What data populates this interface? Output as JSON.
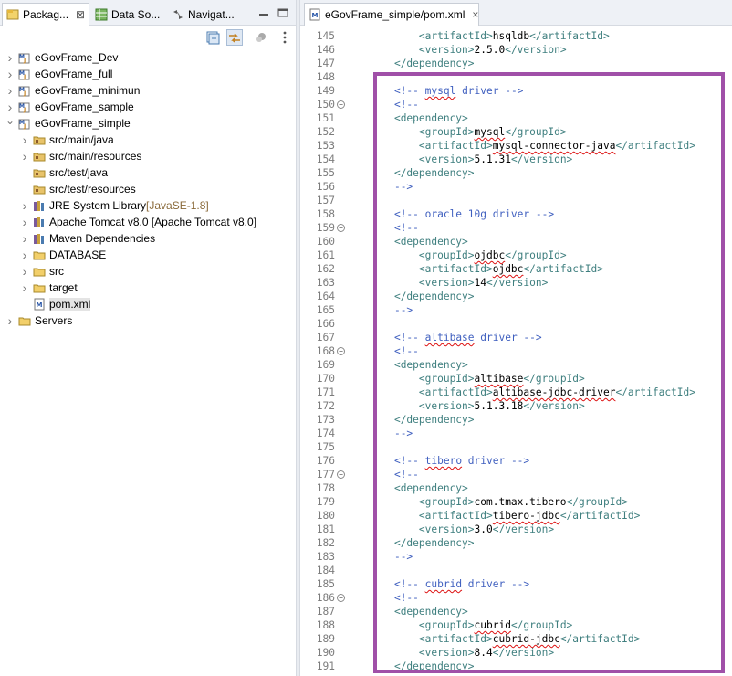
{
  "left_tabs": [
    {
      "label": "Packag...",
      "icon": "package-explorer-icon",
      "active": true
    },
    {
      "label": "Data So...",
      "icon": "data-source-icon"
    },
    {
      "label": "Navigat...",
      "icon": "navigator-icon"
    }
  ],
  "editor_tab": {
    "label": "eGovFrame_simple/pom.xml",
    "close": "×"
  },
  "tree": [
    {
      "label": "eGovFrame_Dev",
      "level": 0,
      "expanded": false,
      "icon": "maven-project-icon"
    },
    {
      "label": "eGovFrame_full",
      "level": 0,
      "expanded": false,
      "icon": "maven-project-icon"
    },
    {
      "label": "eGovFrame_minimun",
      "level": 0,
      "expanded": false,
      "icon": "maven-project-icon"
    },
    {
      "label": "eGovFrame_sample",
      "level": 0,
      "expanded": false,
      "icon": "maven-project-icon"
    },
    {
      "label": "eGovFrame_simple",
      "level": 0,
      "expanded": true,
      "icon": "maven-project-icon"
    },
    {
      "label": "src/main/java",
      "level": 1,
      "expanded": false,
      "icon": "source-folder-icon"
    },
    {
      "label": "src/main/resources",
      "level": 1,
      "expanded": false,
      "icon": "source-folder-icon"
    },
    {
      "label": "src/test/java",
      "level": 1,
      "expanded": null,
      "icon": "source-folder-icon"
    },
    {
      "label": "src/test/resources",
      "level": 1,
      "expanded": null,
      "icon": "source-folder-icon"
    },
    {
      "label": "JRE System Library",
      "decor": "[JavaSE-1.8]",
      "level": 1,
      "expanded": false,
      "icon": "library-icon"
    },
    {
      "label": "Apache Tomcat v8.0 [Apache Tomcat v8.0]",
      "level": 1,
      "expanded": false,
      "icon": "library-icon"
    },
    {
      "label": "Maven Dependencies",
      "level": 1,
      "expanded": false,
      "icon": "library-icon"
    },
    {
      "label": "DATABASE",
      "level": 1,
      "expanded": false,
      "icon": "folder-icon"
    },
    {
      "label": "src",
      "level": 1,
      "expanded": false,
      "icon": "folder-icon"
    },
    {
      "label": "target",
      "level": 1,
      "expanded": false,
      "icon": "folder-icon"
    },
    {
      "label": "pom.xml",
      "level": 1,
      "expanded": null,
      "icon": "xml-file-icon",
      "selected": true
    },
    {
      "label": "Servers",
      "level": 0,
      "expanded": false,
      "icon": "folder-icon"
    }
  ],
  "code_lines": [
    {
      "n": "145",
      "parts": [
        [
          "i",
          "        "
        ],
        [
          "tag",
          "<artifactId>"
        ],
        [
          "txt",
          "hsqldb"
        ],
        [
          "tag",
          "</artifactId>"
        ]
      ]
    },
    {
      "n": "146",
      "parts": [
        [
          "i",
          "        "
        ],
        [
          "tag",
          "<version>"
        ],
        [
          "txt",
          "2.5.0"
        ],
        [
          "tag",
          "</version>"
        ]
      ]
    },
    {
      "n": "147",
      "parts": [
        [
          "i",
          "    "
        ],
        [
          "tag",
          "</dependency>"
        ]
      ]
    },
    {
      "n": "148",
      "parts": []
    },
    {
      "n": "149",
      "parts": [
        [
          "i",
          "    "
        ],
        [
          "cmt",
          "<!-- "
        ],
        [
          "cmtsq",
          "mysql"
        ],
        [
          "cmt",
          " driver -->"
        ]
      ]
    },
    {
      "n": "150",
      "fold": true,
      "parts": [
        [
          "i",
          "    "
        ],
        [
          "cmt",
          "<!--"
        ]
      ]
    },
    {
      "n": "151",
      "parts": [
        [
          "i",
          "    "
        ],
        [
          "tag",
          "<dependency>"
        ]
      ]
    },
    {
      "n": "152",
      "parts": [
        [
          "i",
          "        "
        ],
        [
          "tag",
          "<groupId>"
        ],
        [
          "txtsq",
          "mysql"
        ],
        [
          "tag",
          "</groupId>"
        ]
      ]
    },
    {
      "n": "153",
      "parts": [
        [
          "i",
          "        "
        ],
        [
          "tag",
          "<artifactId>"
        ],
        [
          "txtsq",
          "mysql-connector-java"
        ],
        [
          "tag",
          "</artifactId>"
        ]
      ]
    },
    {
      "n": "154",
      "parts": [
        [
          "i",
          "        "
        ],
        [
          "tag",
          "<version>"
        ],
        [
          "txt",
          "5.1.31"
        ],
        [
          "tag",
          "</version>"
        ]
      ]
    },
    {
      "n": "155",
      "parts": [
        [
          "i",
          "    "
        ],
        [
          "tag",
          "</dependency>"
        ]
      ]
    },
    {
      "n": "156",
      "parts": [
        [
          "i",
          "    "
        ],
        [
          "cmt",
          "-->"
        ]
      ]
    },
    {
      "n": "157",
      "parts": []
    },
    {
      "n": "158",
      "parts": [
        [
          "i",
          "    "
        ],
        [
          "cmt",
          "<!-- oracle 10g driver -->"
        ]
      ]
    },
    {
      "n": "159",
      "fold": true,
      "parts": [
        [
          "i",
          "    "
        ],
        [
          "cmt",
          "<!--"
        ]
      ]
    },
    {
      "n": "160",
      "parts": [
        [
          "i",
          "    "
        ],
        [
          "tag",
          "<dependency>"
        ]
      ]
    },
    {
      "n": "161",
      "parts": [
        [
          "i",
          "        "
        ],
        [
          "tag",
          "<groupId>"
        ],
        [
          "txtsq",
          "ojdbc"
        ],
        [
          "tag",
          "</groupId>"
        ]
      ]
    },
    {
      "n": "162",
      "parts": [
        [
          "i",
          "        "
        ],
        [
          "tag",
          "<artifactId>"
        ],
        [
          "txtsq",
          "ojdbc"
        ],
        [
          "tag",
          "</artifactId>"
        ]
      ]
    },
    {
      "n": "163",
      "parts": [
        [
          "i",
          "        "
        ],
        [
          "tag",
          "<version>"
        ],
        [
          "txt",
          "14"
        ],
        [
          "tag",
          "</version>"
        ]
      ]
    },
    {
      "n": "164",
      "parts": [
        [
          "i",
          "    "
        ],
        [
          "tag",
          "</dependency>"
        ]
      ]
    },
    {
      "n": "165",
      "parts": [
        [
          "i",
          "    "
        ],
        [
          "cmt",
          "-->"
        ]
      ]
    },
    {
      "n": "166",
      "parts": []
    },
    {
      "n": "167",
      "parts": [
        [
          "i",
          "    "
        ],
        [
          "cmt",
          "<!-- "
        ],
        [
          "cmtsq",
          "altibase"
        ],
        [
          "cmt",
          " driver -->"
        ]
      ]
    },
    {
      "n": "168",
      "fold": true,
      "parts": [
        [
          "i",
          "    "
        ],
        [
          "cmt",
          "<!--"
        ]
      ]
    },
    {
      "n": "169",
      "parts": [
        [
          "i",
          "    "
        ],
        [
          "tag",
          "<dependency>"
        ]
      ]
    },
    {
      "n": "170",
      "parts": [
        [
          "i",
          "        "
        ],
        [
          "tag",
          "<groupId>"
        ],
        [
          "txtsq",
          "altibase"
        ],
        [
          "tag",
          "</groupId>"
        ]
      ]
    },
    {
      "n": "171",
      "parts": [
        [
          "i",
          "        "
        ],
        [
          "tag",
          "<artifactId>"
        ],
        [
          "txtsq",
          "altibase-jdbc-driver"
        ],
        [
          "tag",
          "</artifactId>"
        ]
      ]
    },
    {
      "n": "172",
      "parts": [
        [
          "i",
          "        "
        ],
        [
          "tag",
          "<version>"
        ],
        [
          "txt",
          "5.1.3.18"
        ],
        [
          "tag",
          "</version>"
        ]
      ]
    },
    {
      "n": "173",
      "parts": [
        [
          "i",
          "    "
        ],
        [
          "tag",
          "</dependency>"
        ]
      ]
    },
    {
      "n": "174",
      "parts": [
        [
          "i",
          "    "
        ],
        [
          "cmt",
          "-->"
        ]
      ]
    },
    {
      "n": "175",
      "parts": []
    },
    {
      "n": "176",
      "parts": [
        [
          "i",
          "    "
        ],
        [
          "cmt",
          "<!-- "
        ],
        [
          "cmtsq",
          "tibero"
        ],
        [
          "cmt",
          " driver -->"
        ]
      ]
    },
    {
      "n": "177",
      "fold": true,
      "parts": [
        [
          "i",
          "    "
        ],
        [
          "cmt",
          "<!--"
        ]
      ]
    },
    {
      "n": "178",
      "parts": [
        [
          "i",
          "    "
        ],
        [
          "tag",
          "<dependency>"
        ]
      ]
    },
    {
      "n": "179",
      "parts": [
        [
          "i",
          "        "
        ],
        [
          "tag",
          "<groupId>"
        ],
        [
          "txt",
          "com.tmax.tibero"
        ],
        [
          "tag",
          "</groupId>"
        ]
      ]
    },
    {
      "n": "180",
      "parts": [
        [
          "i",
          "        "
        ],
        [
          "tag",
          "<artifactId>"
        ],
        [
          "txtsq",
          "tibero-jdbc"
        ],
        [
          "tag",
          "</artifactId>"
        ]
      ]
    },
    {
      "n": "181",
      "parts": [
        [
          "i",
          "        "
        ],
        [
          "tag",
          "<version>"
        ],
        [
          "txt",
          "3.0"
        ],
        [
          "tag",
          "</version>"
        ]
      ]
    },
    {
      "n": "182",
      "parts": [
        [
          "i",
          "    "
        ],
        [
          "tag",
          "</dependency>"
        ]
      ]
    },
    {
      "n": "183",
      "parts": [
        [
          "i",
          "    "
        ],
        [
          "cmt",
          "-->"
        ]
      ]
    },
    {
      "n": "184",
      "parts": []
    },
    {
      "n": "185",
      "parts": [
        [
          "i",
          "    "
        ],
        [
          "cmt",
          "<!-- "
        ],
        [
          "cmtsq",
          "cubrid"
        ],
        [
          "cmt",
          " driver -->"
        ]
      ]
    },
    {
      "n": "186",
      "fold": true,
      "parts": [
        [
          "i",
          "    "
        ],
        [
          "cmt",
          "<!--"
        ]
      ]
    },
    {
      "n": "187",
      "parts": [
        [
          "i",
          "    "
        ],
        [
          "tag",
          "<dependency>"
        ]
      ]
    },
    {
      "n": "188",
      "parts": [
        [
          "i",
          "        "
        ],
        [
          "tag",
          "<groupId>"
        ],
        [
          "txtsq",
          "cubrid"
        ],
        [
          "tag",
          "</groupId>"
        ]
      ]
    },
    {
      "n": "189",
      "parts": [
        [
          "i",
          "        "
        ],
        [
          "tag",
          "<artifactId>"
        ],
        [
          "txtsq",
          "cubrid-jdbc"
        ],
        [
          "tag",
          "</artifactId>"
        ]
      ]
    },
    {
      "n": "190",
      "parts": [
        [
          "i",
          "        "
        ],
        [
          "tag",
          "<version>"
        ],
        [
          "txt",
          "8.4"
        ],
        [
          "tag",
          "</version>"
        ]
      ]
    },
    {
      "n": "191",
      "parts": [
        [
          "i",
          "    "
        ],
        [
          "tag",
          "</dependency>"
        ]
      ]
    }
  ],
  "colors": {
    "highlight_box": "#a050a8",
    "tag": "#3f7f7f",
    "comment": "#3f5fbf"
  }
}
